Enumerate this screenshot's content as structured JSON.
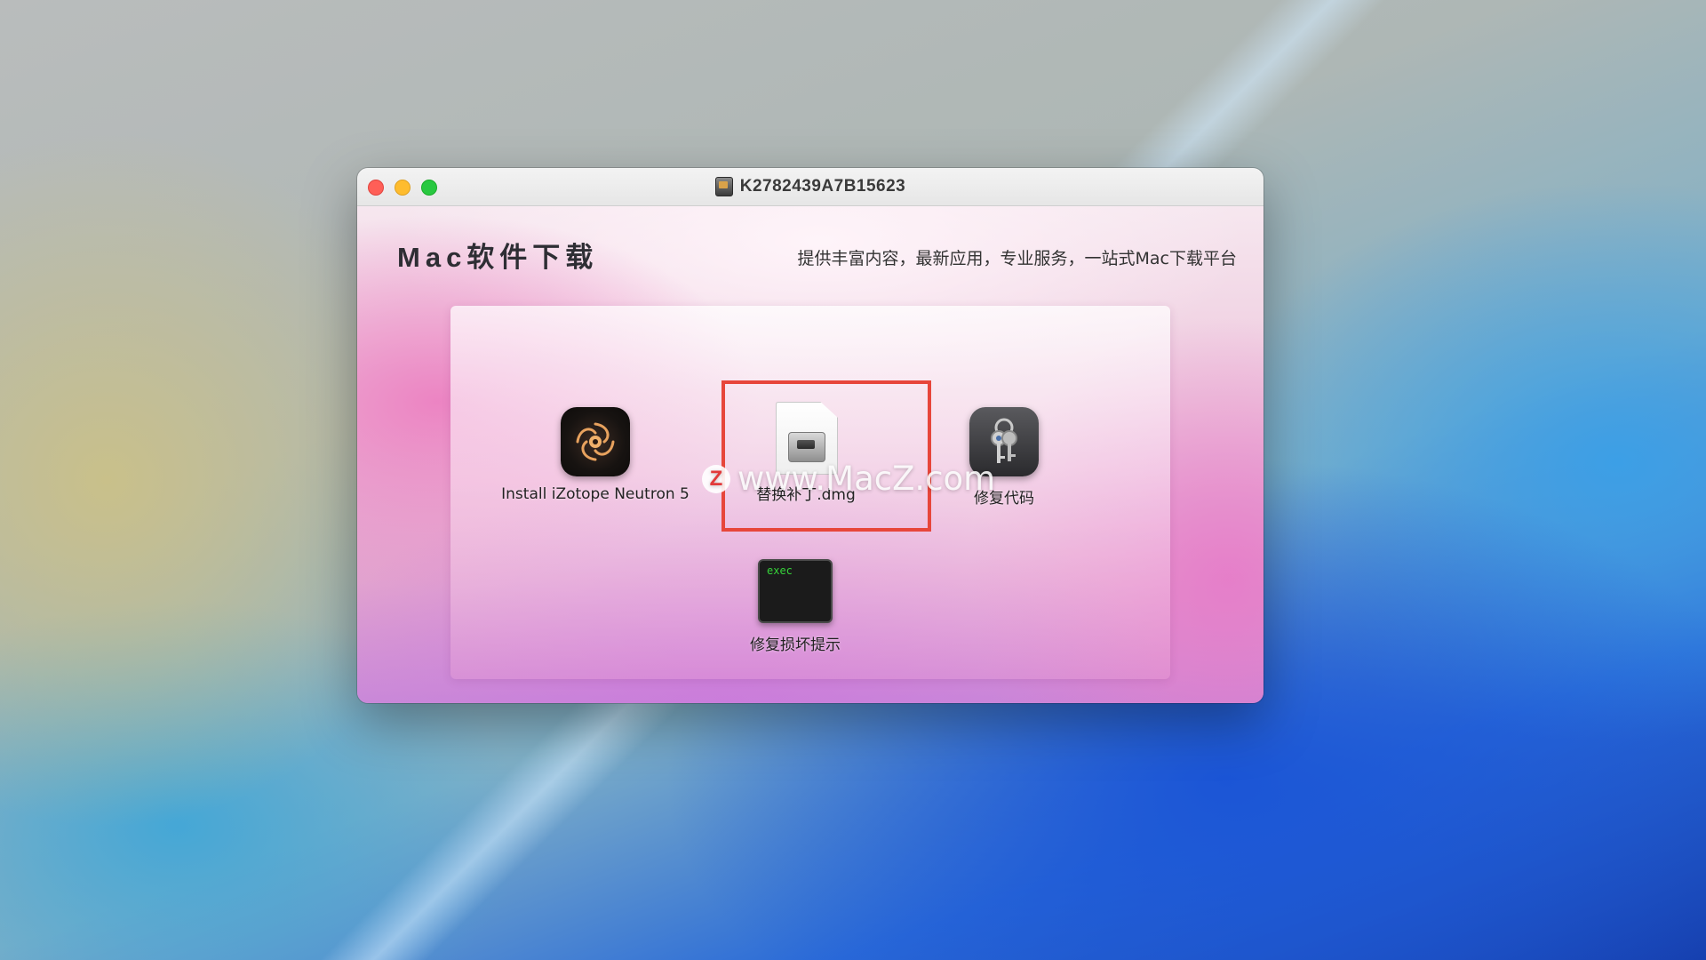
{
  "window": {
    "title": "K2782439A7B15623",
    "brand": "Mac软件下载",
    "tagline": "提供丰富内容，最新应用，专业服务，一站式Mac下载平台"
  },
  "items": [
    {
      "label": "Install iZotope Neutron 5",
      "icon": "izotope-neutron-icon"
    },
    {
      "label": "替换补丁.dmg",
      "icon": "dmg-file-icon"
    },
    {
      "label": "修复代码",
      "icon": "keychain-icon"
    },
    {
      "label": "修复损坏提示",
      "icon": "exec-terminal-icon",
      "icon_text": "exec"
    }
  ],
  "watermark": {
    "logo": "Z",
    "text": "www.MacZ.com"
  },
  "colors": {
    "highlight": "#e7463b",
    "close": "#ff5f57",
    "minimize": "#febc2e",
    "zoom": "#28c840"
  }
}
